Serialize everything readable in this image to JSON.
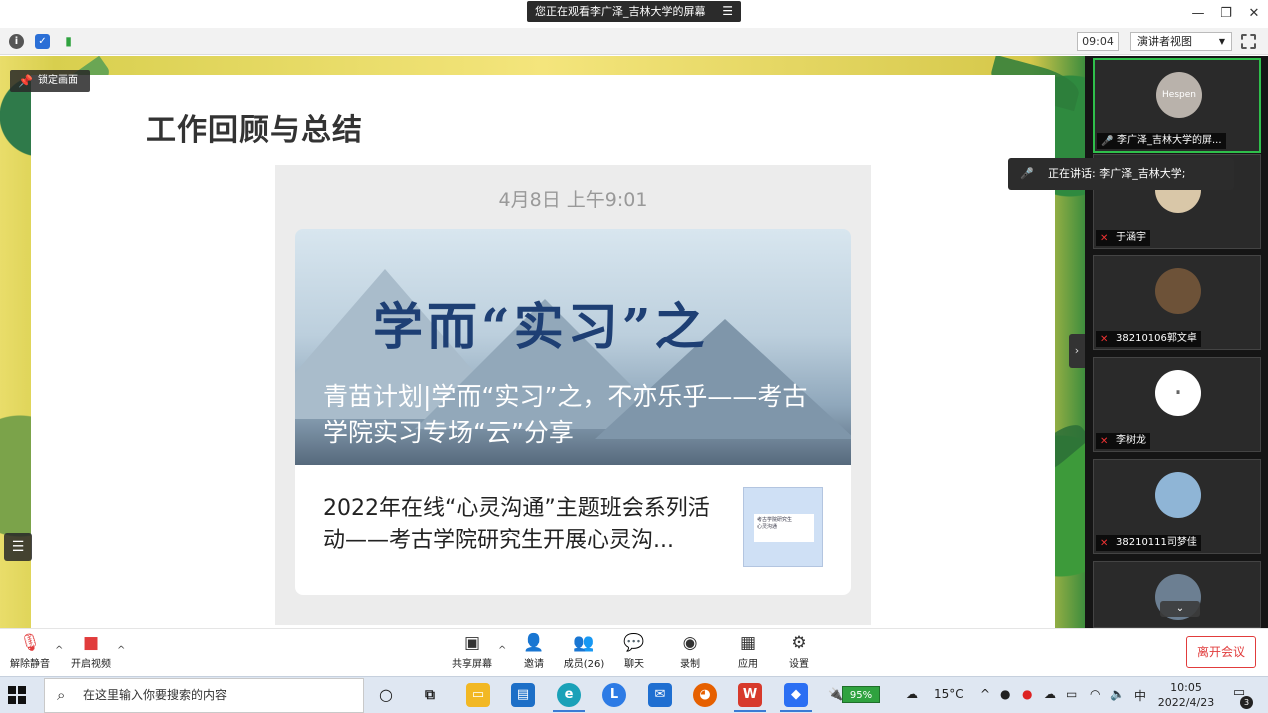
{
  "window": {
    "share_banner": "您正在观看李广泽_吉林大学的屏幕",
    "banner_menu_icon": "menu-icon",
    "controls": [
      "minimize",
      "restore",
      "close"
    ]
  },
  "toolbar": {
    "time": "09:04",
    "view_button": "演讲者视图",
    "icons": [
      "info-icon",
      "shield-icon",
      "signal-icon",
      "fullscreen-icon"
    ]
  },
  "stage": {
    "lock_label": "锁定画面",
    "slide_title": "工作回顾与总结",
    "article": {
      "date": "4月8日 上午9:01",
      "banner_title": "学而“实习”之",
      "card1_caption": "青苗计划|学而“实习”之，不亦乐乎——考古学院实习专场“云”分享",
      "card2_text": "2022年在线“心灵沟通”主题班会系列活动——考古学院研究生开展心灵沟...",
      "thumb_title": "考古学院研究生",
      "thumb_sub": "心灵沟通"
    }
  },
  "speaking": {
    "text": "正在讲话: 李广泽_吉林大学;"
  },
  "participants": [
    {
      "name": "李广泽_吉林大学的屏...",
      "avatar_text": "Hespen",
      "active": true,
      "muted": false
    },
    {
      "name": "于涵宇",
      "active": false,
      "muted": true
    },
    {
      "name": "38210106郭文卓",
      "active": false,
      "muted": true
    },
    {
      "name": "李树龙",
      "active": false,
      "muted": true
    },
    {
      "name": "38210111司梦佳",
      "active": false,
      "muted": true
    }
  ],
  "meeting_controls": {
    "unmute": "解除静音",
    "start_video": "开启视频",
    "share_screen": "共享屏幕",
    "invite": "邀请",
    "members": "成员(26)",
    "chat": "聊天",
    "record": "录制",
    "apps": "应用",
    "settings": "设置",
    "leave": "离开会议"
  },
  "taskbar": {
    "search_placeholder": "在这里输入你要搜索的内容",
    "battery": "95%",
    "weather": "15°C",
    "ime": "中",
    "time": "10:05",
    "date": "2022/4/23",
    "notifications": "3"
  },
  "colors": {
    "accent_green": "#2fbf4b",
    "leave_red": "#e13c3c",
    "banner_blue": "#1e3f74"
  }
}
